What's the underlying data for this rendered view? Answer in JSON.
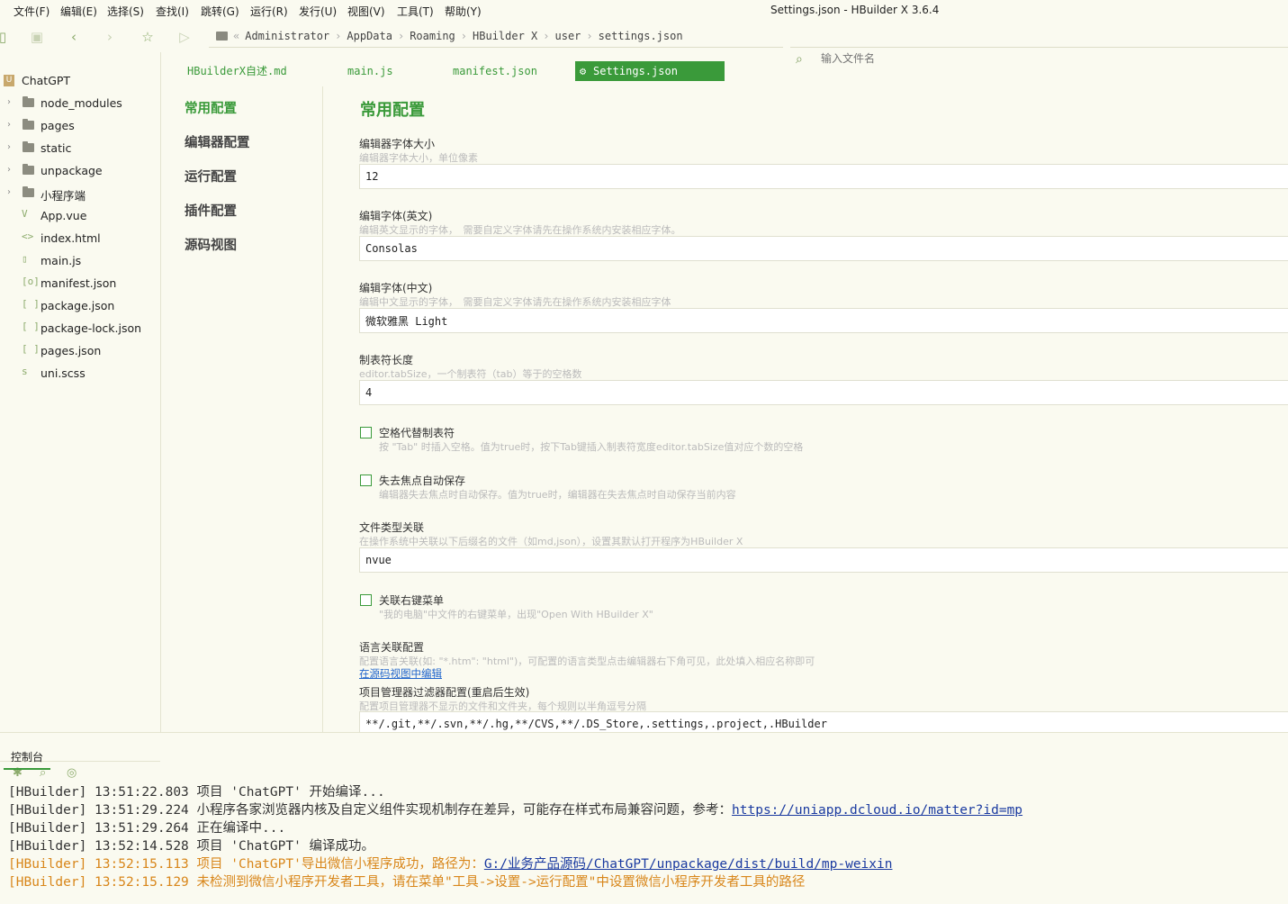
{
  "menubar": {
    "items": [
      "文件(F)",
      "编辑(E)",
      "选择(S)",
      "查找(I)",
      "跳转(G)",
      "运行(R)",
      "发行(U)",
      "视图(V)",
      "工具(T)",
      "帮助(Y)"
    ],
    "window_title": "Settings.json - HBuilder X 3.6.4"
  },
  "toolbar": {
    "breadcrumbs": [
      "Administrator",
      "AppData",
      "Roaming",
      "HBuilder X",
      "user",
      "settings.json"
    ],
    "search_placeholder": "输入文件名"
  },
  "sidebar": {
    "project": "ChatGPT",
    "folders": [
      "node_modules",
      "pages",
      "static",
      "unpackage",
      "小程序端"
    ],
    "files": [
      {
        "name": "App.vue",
        "icon": "V"
      },
      {
        "name": "index.html",
        "icon": "<>"
      },
      {
        "name": "main.js",
        "icon": "js-file-icon"
      },
      {
        "name": "manifest.json",
        "icon": "[o]"
      },
      {
        "name": "package.json",
        "icon": "[ ]"
      },
      {
        "name": "package-lock.json",
        "icon": "[ ]"
      },
      {
        "name": "pages.json",
        "icon": "[ ]"
      },
      {
        "name": "uni.scss",
        "icon": "s"
      }
    ]
  },
  "tabs": [
    "HBuilderX自述.md",
    "main.js",
    "manifest.json",
    "Settings.json"
  ],
  "settings_nav": [
    "常用配置",
    "编辑器配置",
    "运行配置",
    "插件配置",
    "源码视图"
  ],
  "content": {
    "title": "常用配置",
    "font_size": {
      "label": "编辑器字体大小",
      "desc": "编辑器字体大小，单位像素",
      "value": "12"
    },
    "font_en": {
      "label": "编辑字体(英文)",
      "desc": "编辑英文显示的字体，　需要自定义字体请先在操作系统内安装相应字体。",
      "value": "Consolas"
    },
    "font_cn": {
      "label": "编辑字体(中文)",
      "desc": "编辑中文显示的字体，　需要自定义字体请先在操作系统内安装相应字体",
      "value": "微软雅黑 Light"
    },
    "tab_size": {
      "label": "制表符长度",
      "desc": "editor.tabSize，一个制表符（tab）等于的空格数",
      "value": "4"
    },
    "insert_spaces": {
      "label": "空格代替制表符",
      "desc": "按 \"Tab\" 时插入空格。值为true时，按下Tab键插入制表符宽度editor.tabSize值对应个数的空格"
    },
    "auto_save": {
      "label": "失去焦点自动保存",
      "desc": "编辑器失去焦点时自动保存。值为true时，编辑器在失去焦点时自动保存当前内容"
    },
    "file_assoc": {
      "label": "文件类型关联",
      "desc": "在操作系统中关联以下后缀名的文件（如md,json），设置其默认打开程序为HBuilder X",
      "value": "nvue"
    },
    "context_menu": {
      "label": "关联右键菜单",
      "desc": "\"我的电脑\"中文件的右键菜单，出现\"Open With HBuilder X\""
    },
    "lang_assoc": {
      "label": "语言关联配置",
      "desc": "配置语言关联(如: \"*.htm\": \"html\")，可配置的语言类型点击编辑器右下角可见，此处填入相应名称即可",
      "link": "在源码视图中编辑"
    },
    "filter": {
      "label": "项目管理器过滤器配置(重启后生效)",
      "desc": "配置项目管理器不显示的文件和文件夹，每个规则以半角逗号分隔",
      "value": "**/.git,**/.svn,**/.hg,**/CVS,**/.DS_Store,.settings,.project,.HBuilder"
    }
  },
  "console": {
    "tab_label": "控制台",
    "lines": [
      {
        "prefix": "[HBuilder] 13:51:22.803",
        "text": "项目 'ChatGPT' 开始编译...",
        "link": ""
      },
      {
        "prefix": "[HBuilder] 13:51:29.224",
        "text": "小程序各家浏览器内核及自定义组件实现机制存在差异，可能存在样式布局兼容问题，参考：",
        "link": "https://uniapp.dcloud.io/matter?id=mp"
      },
      {
        "prefix": "[HBuilder] 13:51:29.264",
        "text": "正在编译中...",
        "link": ""
      },
      {
        "prefix": "[HBuilder] 13:52:14.528",
        "text": "项目 'ChatGPT' 编译成功。",
        "link": ""
      },
      {
        "prefix": "[HBuilder] 13:52:15.113",
        "text": "项目 'ChatGPT'导出微信小程序成功，路径为：",
        "link": "G:/业务产品源码/ChatGPT/unpackage/dist/build/mp-weixin"
      },
      {
        "prefix": "[HBuilder] 13:52:15.129",
        "text": "未检测到微信小程序开发者工具，请在菜单\"工具->设置->运行配置\"中设置微信小程序开发者工具的路径",
        "link": ""
      }
    ]
  },
  "colors": {
    "accent": "#3a9a3a",
    "warn": "#d8861a",
    "link": "#1a3aa0",
    "background": "#fafaf0"
  }
}
